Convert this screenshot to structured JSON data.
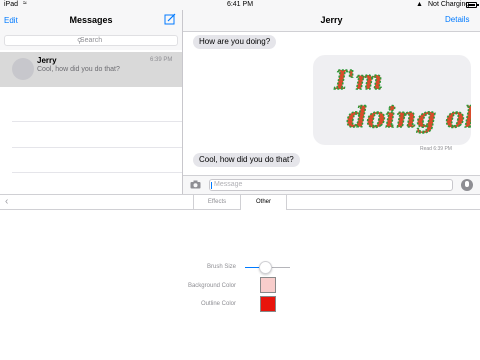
{
  "status_bar": {
    "carrier": "iPad",
    "time": "6:41 PM",
    "charging": "Not Charging"
  },
  "conversations": {
    "title": "Messages",
    "edit_label": "Edit",
    "search_placeholder": "Search",
    "items": [
      {
        "name": "Jerry",
        "preview": "Cool, how did you do that?",
        "time": "6:39 PM"
      }
    ]
  },
  "chat": {
    "contact": "Jerry",
    "details_label": "Details",
    "messages": [
      {
        "text": "How are you doing?"
      },
      {
        "sticker_text": "I'm doing ok",
        "sticker_colors": {
          "fill": "#d94b2b",
          "outline": "#2e9a3a"
        }
      },
      {
        "text": "Cool, how did you do that?"
      }
    ],
    "read_receipt": "Read 6:39 PM",
    "input_placeholder": "Message"
  },
  "extension": {
    "tabs": [
      "Effects",
      "Other"
    ],
    "active_tab": "Other",
    "brush_size_label": "Brush Size",
    "brush_size_value": 0.45,
    "background_color_label": "Background Color",
    "background_color": "#f8cdcb",
    "outline_color_label": "Outline Color",
    "outline_color": "#e8140c"
  },
  "colors": {
    "accent": "#007aff",
    "bubble": "#e5e5ea"
  }
}
